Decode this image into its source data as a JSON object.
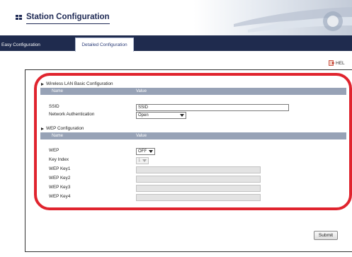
{
  "header": {
    "title": "Station Configuration"
  },
  "tabs": [
    {
      "label": "Easy Configuration",
      "active": false
    },
    {
      "label": "Detailed Configuration",
      "active": true
    }
  ],
  "help": {
    "label": "HEL"
  },
  "wireless": {
    "title": "Wireless LAN Basic Configuration",
    "col_name": "Name",
    "col_value": "Value",
    "ssid_label": "SSID",
    "ssid_value": "SSID",
    "auth_label": "Network Authentication",
    "auth_value": "Open"
  },
  "wep": {
    "title": "WEP Configuration",
    "col_name": "Name",
    "col_value": "Value",
    "wep_label": "WEP",
    "wep_value": "OFF",
    "key_index_label": "Key Index",
    "key_index_value": "1",
    "key1_label": "WEP Key1",
    "key2_label": "WEP Key2",
    "key3_label": "WEP Key3",
    "key4_label": "WEP Key4"
  },
  "submit": {
    "label": "Submit"
  },
  "colors": {
    "nav": "#1f2b4e",
    "table_header": "#97a2b6",
    "highlight": "#e0242e"
  }
}
